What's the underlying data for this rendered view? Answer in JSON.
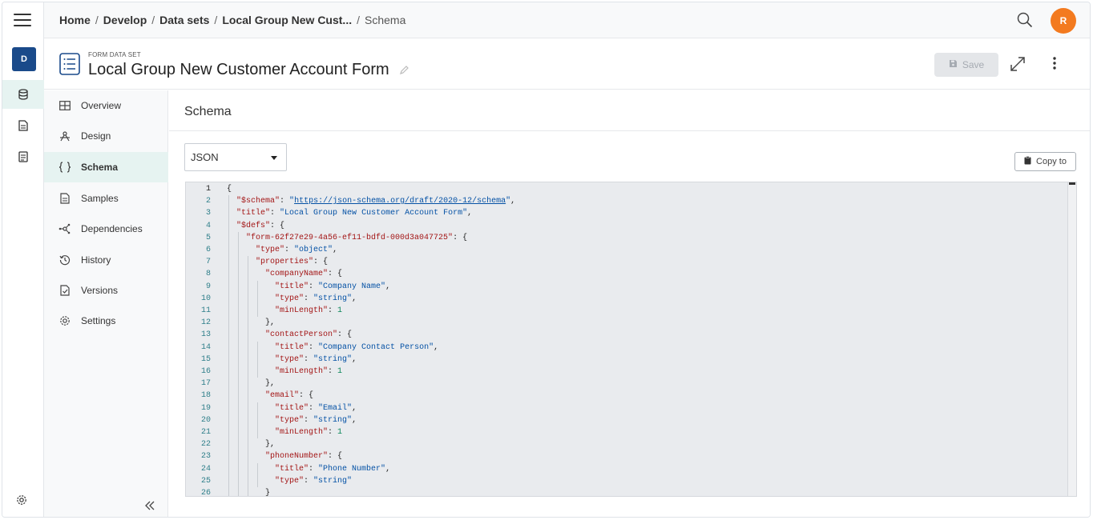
{
  "rail": {
    "avatar_letter": "D"
  },
  "breadcrumb": {
    "items": [
      "Home",
      "Develop",
      "Data sets",
      "Local Group New Cust..."
    ],
    "current": "Schema",
    "separator": "/"
  },
  "user": {
    "initial": "R"
  },
  "header": {
    "type_label": "FORM DATA SET",
    "title": "Local Group New Customer Account Form",
    "save_label": "Save"
  },
  "sidebar": {
    "items": [
      {
        "label": "Overview",
        "icon": "grid-icon"
      },
      {
        "label": "Design",
        "icon": "design-icon"
      },
      {
        "label": "Schema",
        "icon": "braces-icon",
        "active": true
      },
      {
        "label": "Samples",
        "icon": "document-icon"
      },
      {
        "label": "Dependencies",
        "icon": "network-icon"
      },
      {
        "label": "History",
        "icon": "history-icon"
      },
      {
        "label": "Versions",
        "icon": "versions-icon"
      },
      {
        "label": "Settings",
        "icon": "gear-icon"
      }
    ]
  },
  "content": {
    "section_title": "Schema",
    "format_select": "JSON",
    "copy_label": "Copy to"
  },
  "editor": {
    "line_numbers": [
      "1",
      "2",
      "3",
      "4",
      "5",
      "6",
      "7",
      "8",
      "9",
      "10",
      "11",
      "12",
      "13",
      "14",
      "15",
      "16",
      "17",
      "18",
      "19",
      "20",
      "21",
      "22",
      "23",
      "24",
      "25",
      "26"
    ],
    "lines": [
      "{",
      "  \"$schema\": \"https://json-schema.org/draft/2020-12/schema\",",
      "  \"title\": \"Local Group New Customer Account Form\",",
      "  \"$defs\": {",
      "    \"form-62f27e29-4a56-ef11-bdfd-000d3a047725\": {",
      "      \"type\": \"object\",",
      "      \"properties\": {",
      "        \"companyName\": {",
      "          \"title\": \"Company Name\",",
      "          \"type\": \"string\",",
      "          \"minLength\": 1",
      "        },",
      "        \"contactPerson\": {",
      "          \"title\": \"Company Contact Person\",",
      "          \"type\": \"string\",",
      "          \"minLength\": 1",
      "        },",
      "        \"email\": {",
      "          \"title\": \"Email\",",
      "          \"type\": \"string\",",
      "          \"minLength\": 1",
      "        },",
      "        \"phoneNumber\": {",
      "          \"title\": \"Phone Number\",",
      "          \"type\": \"string\"",
      "        }"
    ]
  },
  "colors": {
    "accent": "#1a4a8a",
    "avatar": "#f37a1f",
    "active_bg": "#e6f3f1",
    "key": "#a31515",
    "string": "#0451a5",
    "number": "#098658"
  }
}
